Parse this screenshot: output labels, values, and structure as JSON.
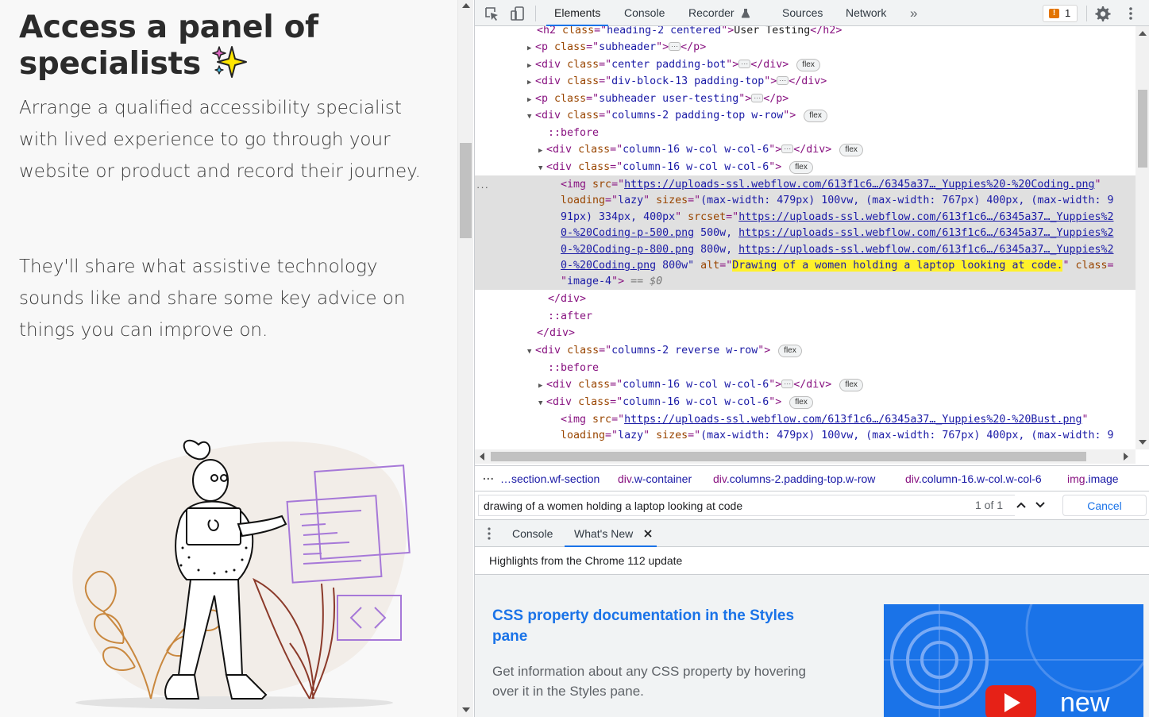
{
  "webpage": {
    "heading": "Access a panel of specialists",
    "heading_line1": "Access a panel of",
    "heading_line2": "specialists",
    "sparkle_icon": "sparkles-emoji",
    "paragraph1": "Arrange a qualified accessibility specialist with lived experience to go through your website or product and record their journey.",
    "paragraph2": "They'll share what assistive technology sounds like and share some key advice on things you can improve on.",
    "illustration_alt": "Drawing of a women holding a laptop looking at code.",
    "colors": {
      "heading": "#2b2b2b",
      "body": "#3c3c3c",
      "background": "#f8f8f8"
    }
  },
  "devtools": {
    "tabs": [
      "Elements",
      "Console",
      "Recorder",
      "Sources",
      "Network"
    ],
    "active_tab": "Elements",
    "more_tabs": "»",
    "issues_count": "1",
    "tree": {
      "l0": [
        "h2",
        "class",
        "heading-2 centered",
        "User Testing"
      ],
      "l1": [
        "p",
        "class",
        "subheader"
      ],
      "l2": [
        "div",
        "class",
        "center padding-bot",
        "flex"
      ],
      "l3": [
        "div",
        "class",
        "div-block-13 padding-top"
      ],
      "l4": [
        "p",
        "class",
        "subheader user-testing"
      ],
      "l5": [
        "div",
        "class",
        "columns-2 padding-top w-row",
        "flex"
      ],
      "l6": "::before",
      "l7": [
        "div",
        "class",
        "column-16 w-col w-col-6",
        "flex"
      ],
      "l8": [
        "div",
        "class",
        "column-16 w-col w-col-6",
        "flex"
      ],
      "img1": {
        "src": "https://uploads-ssl.webflow.com/613f1c6…/6345a37…_Yuppies%20-%20Coding.png",
        "loading": "lazy",
        "sizes_a": "(max-width: 479px) 100vw, (max-width: 767px) 400px, (max-width: 9",
        "sizes_b": "91px) 334px, 400px",
        "srcset_a": "https://uploads-ssl.webflow.com/613f1c6…/6345a37…_Yuppies%2",
        "srcset_b": "0-%20Coding-p-500.png",
        "w500": " 500w, ",
        "srcset_c": "https://uploads-ssl.webflow.com/613f1c6…/6345a37…_Yuppies%2",
        "srcset_d": "0-%20Coding-p-800.png",
        "w800": " 800w, ",
        "srcset_e": "https://uploads-ssl.webflow.com/613f1c6…/6345a37…_Yuppies%2",
        "srcset_f": "0-%20Coding.png",
        "w800b": " 800w\"",
        "alt": "Drawing of a women holding a laptop looking at code.",
        "class_value": "image-4",
        "eq": "== $0"
      },
      "l_enddiv": "</div>",
      "l_after": "::after",
      "l_enddiv2": "</div>",
      "l9": [
        "div",
        "class",
        "columns-2 reverse w-row",
        "flex"
      ],
      "l10": "::before",
      "l11": [
        "div",
        "class",
        "column-16 w-col w-col-6",
        "flex"
      ],
      "l12": [
        "div",
        "class",
        "column-16 w-col w-col-6",
        "flex"
      ],
      "img2": {
        "src": "https://uploads-ssl.webflow.com/613f1c6…/6345a37…_Yuppies%20-%20Bust.png",
        "loading": "lazy",
        "sizes_a": "(max-width: 479px) 100vw, (max-width: 767px) 400px, (max-width: 9"
      }
    },
    "breadcrumbs": [
      {
        "tag": "",
        "cls": "…section.wf-section"
      },
      {
        "tag": "div",
        "cls": ".w-container"
      },
      {
        "tag": "div",
        "cls": ".columns-2.padding-top.w-row"
      },
      {
        "tag": "div",
        "cls": ".column-16.w-col.w-col-6"
      },
      {
        "tag": "img",
        "cls": ".image"
      }
    ],
    "search": {
      "value": "drawing of a women holding a laptop looking at code",
      "count": "1 of 1",
      "cancel_label": "Cancel"
    },
    "drawer": {
      "tabs": [
        "Console",
        "What's New"
      ],
      "active": "What's New",
      "header": "Highlights from the Chrome 112 update",
      "feature_title": "CSS property documentation in the Styles pane",
      "feature_desc": "Get information about any CSS property by hovering over it in the Styles pane.",
      "thumbnail_text": "new"
    },
    "colors": {
      "accent": "#1a73e8",
      "tag": "#881280",
      "attr_name": "#994500",
      "attr_value": "#1a1aa6",
      "highlight": "#fff12b",
      "issue": "#e37400"
    }
  }
}
